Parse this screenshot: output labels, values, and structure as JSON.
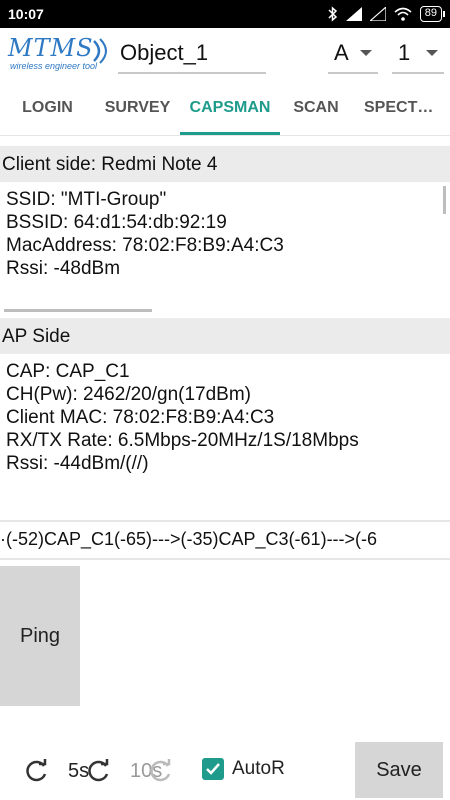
{
  "status_bar": {
    "time": "10:07",
    "battery": "89"
  },
  "app_bar": {
    "logo_text": "MTMS",
    "logo_tagline": "wireless engineer tool",
    "object_name": "Object_1",
    "band_select": "A",
    "index_select": "1"
  },
  "tabs": [
    {
      "label": "LOGIN"
    },
    {
      "label": "SURVEY"
    },
    {
      "label": "CAPSMAN"
    },
    {
      "label": "SCAN"
    },
    {
      "label": "SPECT…"
    }
  ],
  "client_side": {
    "header": "Client side: Redmi Note 4",
    "lines": [
      "SSID: \"MTI-Group\"",
      "BSSID: 64:d1:54:db:92:19",
      "MacAddress: 78:02:F8:B9:A4:C3",
      "Rssi: -48dBm"
    ]
  },
  "ap_side": {
    "header": "AP Side",
    "lines": [
      "CAP: CAP_C1",
      "CH(Pw): 2462/20/gn(17dBm)",
      "Client MAC: 78:02:F8:B9:A4:C3",
      "RX/TX Rate: 6.5Mbps-20MHz/1S/18Mbps",
      "Rssi: -44dBm/(//)"
    ]
  },
  "route": "·(-52)CAP_C1(-65)--->(-35)CAP_C3(-61)--->(-6",
  "ping": {
    "label": "Ping"
  },
  "bottom": {
    "refresh_5": "5s",
    "refresh_10": "10s",
    "autor_label": "AutoR",
    "save_label": "Save"
  },
  "colors": {
    "accent": "#1e9b8a",
    "logo": "#2e79c4",
    "section_bg": "#ebebeb",
    "button_bg": "#d6d6d6"
  }
}
